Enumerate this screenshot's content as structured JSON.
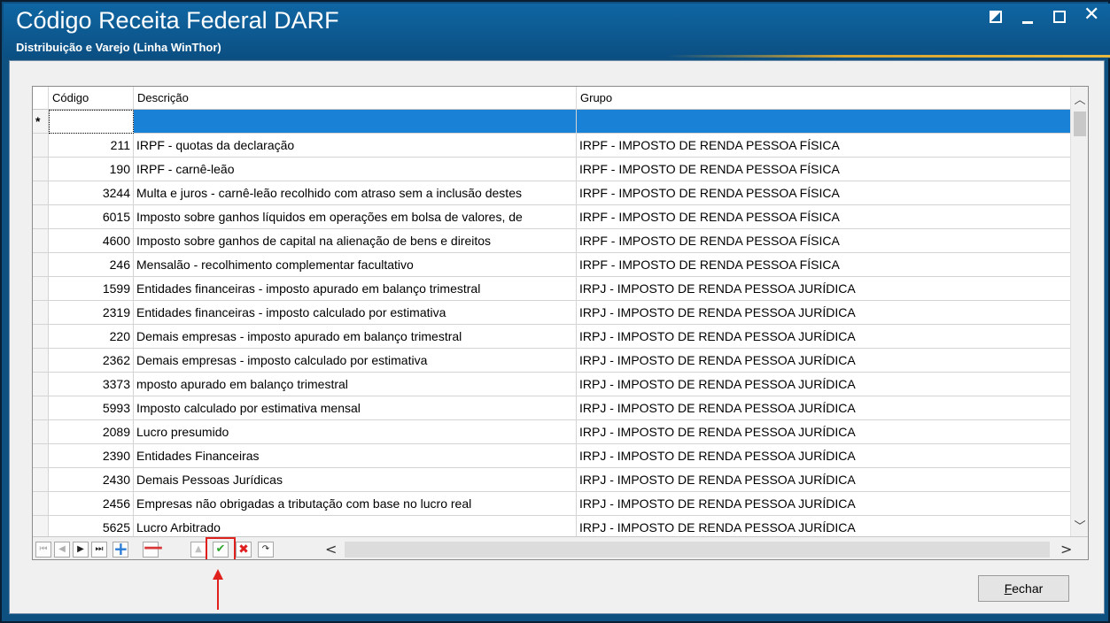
{
  "window": {
    "title": "Código Receita Federal DARF",
    "subtitle": "Distribuição e Varejo (Linha WinThor)"
  },
  "grid": {
    "columns": [
      "Código",
      "Descrição",
      "Grupo"
    ],
    "new_row_marker": "*",
    "rows": [
      {
        "codigo": "211",
        "descricao": "IRPF - quotas da declaração",
        "grupo": "IRPF - IMPOSTO DE RENDA PESSOA FÍSICA"
      },
      {
        "codigo": "190",
        "descricao": "IRPF - carnê-leão",
        "grupo": "IRPF - IMPOSTO DE RENDA PESSOA FÍSICA"
      },
      {
        "codigo": "3244",
        "descricao": "Multa e juros - carnê-leão recolhido com atraso sem a inclusão destes",
        "grupo": "IRPF - IMPOSTO DE RENDA PESSOA FÍSICA"
      },
      {
        "codigo": "6015",
        "descricao": "Imposto sobre ganhos líquidos em operações em bolsa de valores, de",
        "grupo": "IRPF - IMPOSTO DE RENDA PESSOA FÍSICA"
      },
      {
        "codigo": "4600",
        "descricao": "Imposto sobre ganhos de capital na alienação de bens e direitos",
        "grupo": "IRPF - IMPOSTO DE RENDA PESSOA FÍSICA"
      },
      {
        "codigo": "246",
        "descricao": "Mensalão - recolhimento complementar facultativo",
        "grupo": "IRPF - IMPOSTO DE RENDA PESSOA FÍSICA"
      },
      {
        "codigo": "1599",
        "descricao": "Entidades financeiras - imposto apurado em balanço trimestral",
        "grupo": "IRPJ - IMPOSTO DE RENDA PESSOA JURÍDICA"
      },
      {
        "codigo": "2319",
        "descricao": "Entidades financeiras - imposto calculado por estimativa",
        "grupo": "IRPJ - IMPOSTO DE RENDA PESSOA JURÍDICA"
      },
      {
        "codigo": "220",
        "descricao": "Demais empresas - imposto apurado em balanço trimestral",
        "grupo": "IRPJ - IMPOSTO DE RENDA PESSOA JURÍDICA"
      },
      {
        "codigo": "2362",
        "descricao": "Demais empresas - imposto calculado por estimativa",
        "grupo": "IRPJ - IMPOSTO DE RENDA PESSOA JURÍDICA"
      },
      {
        "codigo": "3373",
        "descricao": "mposto apurado em balanço trimestral",
        "grupo": "IRPJ - IMPOSTO DE RENDA PESSOA JURÍDICA"
      },
      {
        "codigo": "5993",
        "descricao": "Imposto calculado por estimativa mensal",
        "grupo": "IRPJ - IMPOSTO DE RENDA PESSOA JURÍDICA"
      },
      {
        "codigo": "2089",
        "descricao": "Lucro presumido",
        "grupo": "IRPJ - IMPOSTO DE RENDA PESSOA JURÍDICA"
      },
      {
        "codigo": "2390",
        "descricao": "Entidades Financeiras",
        "grupo": "IRPJ - IMPOSTO DE RENDA PESSOA JURÍDICA"
      },
      {
        "codigo": "2430",
        "descricao": "Demais Pessoas Jurídicas",
        "grupo": "IRPJ - IMPOSTO DE RENDA PESSOA JURÍDICA"
      },
      {
        "codigo": "2456",
        "descricao": "Empresas não obrigadas a tributação com base no lucro real",
        "grupo": "IRPJ - IMPOSTO DE RENDA PESSOA JURÍDICA"
      },
      {
        "codigo": "5625",
        "descricao": "Lucro Arbitrado",
        "grupo": "IRPJ - IMPOSTO DE RENDA PESSOA JURÍDICA"
      }
    ]
  },
  "navigator": {
    "first": "⏮",
    "prev": "◀",
    "next": "▶",
    "last": "⏭",
    "insert": "+",
    "delete": "—",
    "edit": "▲",
    "post": "✔",
    "cancel": "✖",
    "refresh": "↷",
    "scroll_left": "<",
    "scroll_right": ">"
  },
  "buttons": {
    "fechar_first": "F",
    "fechar_rest": "echar"
  },
  "colors": {
    "title_bar": "#0b5a94",
    "selection": "#1a82d6",
    "highlight": "#e0201c"
  }
}
